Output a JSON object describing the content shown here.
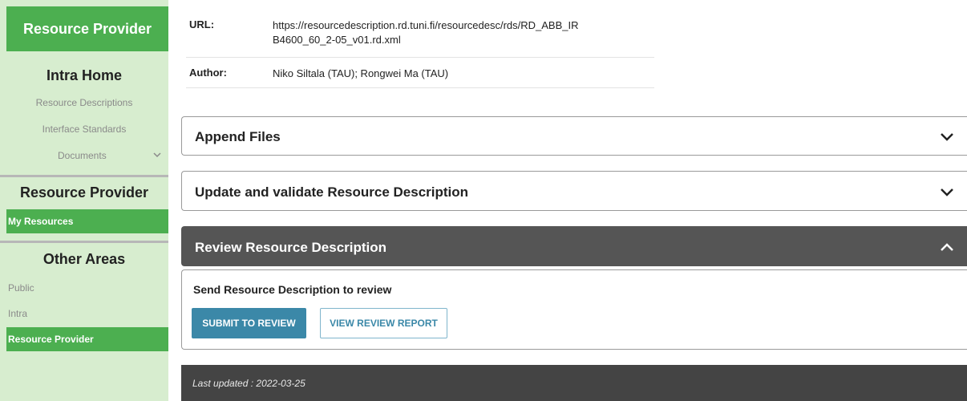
{
  "sidebar": {
    "header": "Resource Provider",
    "intra_home": "Intra Home",
    "links": [
      "Resource Descriptions",
      "Interface Standards"
    ],
    "documents_label": "Documents",
    "section_resource_provider": "Resource Provider",
    "my_resources": "My Resources",
    "section_other_areas": "Other Areas",
    "other_items": [
      "Public",
      "Intra",
      "Resource Provider"
    ]
  },
  "info": {
    "url_label": "URL:",
    "url_value_line1": "https://resourcedescription.rd.tuni.fi/resourcedesc/rds/RD_ABB_IR",
    "url_value_line2": "B4600_60_2-05_v01.rd.xml",
    "author_label": "Author:",
    "author_value": "Niko Siltala (TAU); Rongwei Ma (TAU)"
  },
  "accordions": {
    "append_files": "Append Files",
    "update_validate": "Update and validate Resource Description",
    "review": "Review Resource Description"
  },
  "review_panel": {
    "subtitle": "Send Resource Description to review",
    "submit_button": "SUBMIT TO REVIEW",
    "view_report_button": "VIEW REVIEW REPORT"
  },
  "footer": {
    "last_updated": "Last updated : 2022-03-25"
  },
  "colors": {
    "sidebar_bg": "#d7edcf",
    "accent_green": "#4caf50",
    "button_blue": "#3b88a8",
    "dark_header": "#555555",
    "footer_bg": "#444444"
  }
}
